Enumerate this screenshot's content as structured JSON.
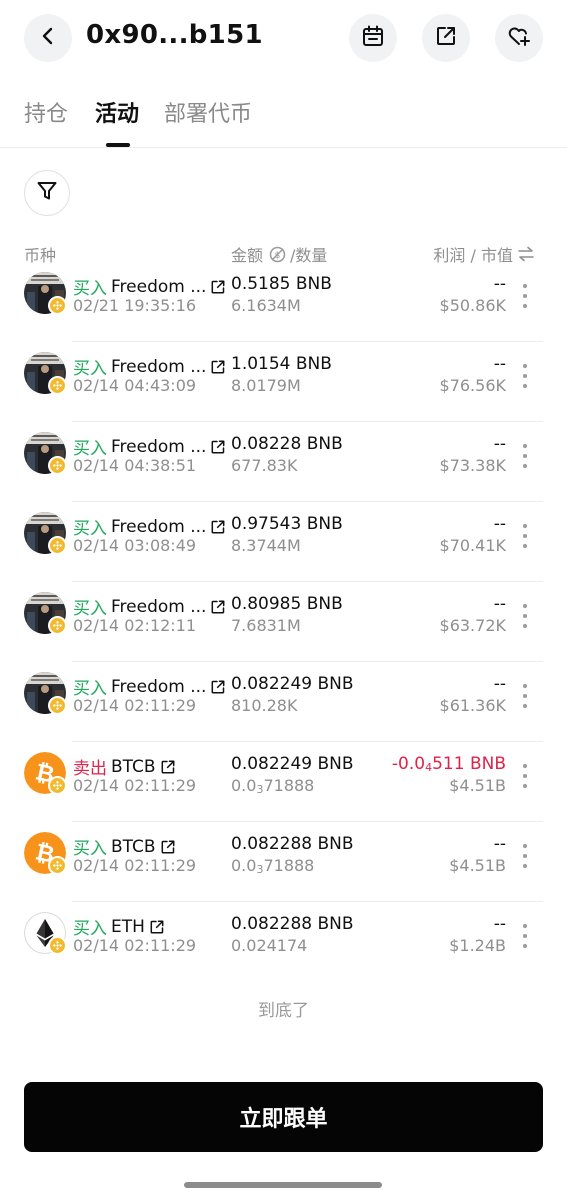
{
  "header": {
    "title": "0x90...b151",
    "icons": [
      "back-icon",
      "calendar-icon",
      "share-icon",
      "favorite-add-icon"
    ]
  },
  "tabs": [
    {
      "label": "持仓",
      "active": false
    },
    {
      "label": "活动",
      "active": true
    },
    {
      "label": "部署代币",
      "active": false
    }
  ],
  "columns": {
    "coin": "币种",
    "amount": "金额",
    "quantity": "/数量",
    "profit": "利润 / 市值"
  },
  "colors": {
    "buy": "#21a95b",
    "sell": "#e0234a",
    "bnb_badge": "#f3ba2f",
    "btc": "#f7931a"
  },
  "rows": [
    {
      "action": "买入",
      "type": "buy",
      "token": "Freedom ...",
      "icon": "freedom-token-icon",
      "time": "02/21 19:35:16",
      "amount": "0.5185 BNB",
      "qty_main": "6.1634M",
      "qty_sub": "",
      "qty_tail": "",
      "profit": "--",
      "mcap": "$50.86K"
    },
    {
      "action": "买入",
      "type": "buy",
      "token": "Freedom ...",
      "icon": "freedom-token-icon",
      "time": "02/14 04:43:09",
      "amount": "1.0154 BNB",
      "qty_main": "8.0179M",
      "qty_sub": "",
      "qty_tail": "",
      "profit": "--",
      "mcap": "$76.56K"
    },
    {
      "action": "买入",
      "type": "buy",
      "token": "Freedom ...",
      "icon": "freedom-token-icon",
      "time": "02/14 04:38:51",
      "amount": "0.08228 BNB",
      "qty_main": "677.83K",
      "qty_sub": "",
      "qty_tail": "",
      "profit": "--",
      "mcap": "$73.38K"
    },
    {
      "action": "买入",
      "type": "buy",
      "token": "Freedom ...",
      "icon": "freedom-token-icon",
      "time": "02/14 03:08:49",
      "amount": "0.97543 BNB",
      "qty_main": "8.3744M",
      "qty_sub": "",
      "qty_tail": "",
      "profit": "--",
      "mcap": "$70.41K"
    },
    {
      "action": "买入",
      "type": "buy",
      "token": "Freedom ...",
      "icon": "freedom-token-icon",
      "time": "02/14 02:12:11",
      "amount": "0.80985 BNB",
      "qty_main": "7.6831M",
      "qty_sub": "",
      "qty_tail": "",
      "profit": "--",
      "mcap": "$63.72K"
    },
    {
      "action": "买入",
      "type": "buy",
      "token": "Freedom ...",
      "icon": "freedom-token-icon",
      "time": "02/14 02:11:29",
      "amount": "0.082249 BNB",
      "qty_main": "810.28K",
      "qty_sub": "",
      "qty_tail": "",
      "profit": "--",
      "mcap": "$61.36K"
    },
    {
      "action": "卖出",
      "type": "sell",
      "token": "BTCB",
      "icon": "btc-icon",
      "time": "02/14 02:11:29",
      "amount": "0.082249 BNB",
      "qty_main": "0.0",
      "qty_sub": "3",
      "qty_tail": "71888",
      "profit": "-0.04511 BNB",
      "profit_main": "-0.0",
      "profit_sub": "4",
      "profit_tail": "511 BNB",
      "mcap": "$4.51B"
    },
    {
      "action": "买入",
      "type": "buy",
      "token": "BTCB",
      "icon": "btc-icon",
      "time": "02/14 02:11:29",
      "amount": "0.082288 BNB",
      "qty_main": "0.0",
      "qty_sub": "3",
      "qty_tail": "71888",
      "profit": "--",
      "mcap": "$4.51B"
    },
    {
      "action": "买入",
      "type": "buy",
      "token": "ETH",
      "icon": "eth-icon",
      "time": "02/14 02:11:29",
      "amount": "0.082288 BNB",
      "qty_main": "0.024174",
      "qty_sub": "",
      "qty_tail": "",
      "profit": "--",
      "mcap": "$1.24B"
    }
  ],
  "footer": {
    "end_text": "到底了",
    "cta_label": "立即跟单"
  }
}
